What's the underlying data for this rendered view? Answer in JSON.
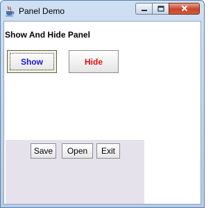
{
  "window": {
    "title": "Panel Demo",
    "icons": {
      "app": "java-cup-icon",
      "minimize": "minimize-icon",
      "maximize": "maximize-icon",
      "close": "close-icon"
    }
  },
  "content": {
    "heading": "Show And Hide Panel",
    "show_label": "Show",
    "hide_label": "Hide",
    "show_color": "#1a1acc",
    "hide_color": "#e01010"
  },
  "panel": {
    "save_label": "Save",
    "open_label": "Open",
    "exit_label": "Exit",
    "background": "#e6e2ec"
  }
}
